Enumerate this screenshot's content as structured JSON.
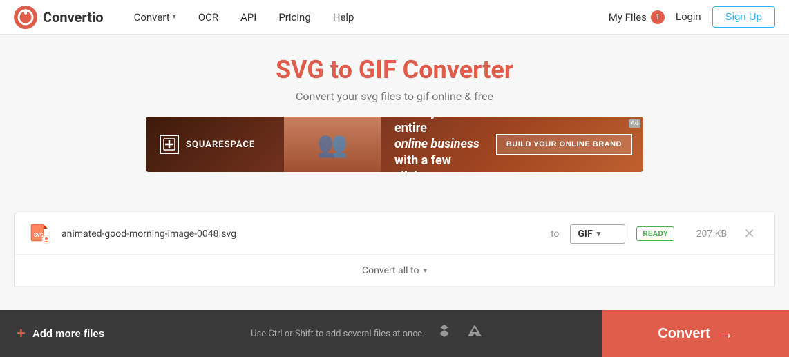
{
  "header": {
    "logo_text": "Convertio",
    "nav": [
      {
        "label": "Convert",
        "has_chevron": true
      },
      {
        "label": "OCR",
        "has_chevron": false
      },
      {
        "label": "API",
        "has_chevron": false
      },
      {
        "label": "Pricing",
        "has_chevron": false
      },
      {
        "label": "Help",
        "has_chevron": false
      }
    ],
    "my_files_label": "My Files",
    "my_files_count": "1",
    "login_label": "Login",
    "signup_label": "Sign Up"
  },
  "main": {
    "title": "SVG to GIF Converter",
    "subtitle": "Convert your svg files to gif online & free"
  },
  "ad": {
    "brand": "SQUARESPACE",
    "headline_line1": "Brand your entire",
    "headline_line2": "online business",
    "headline_line3": "with a few clicks.",
    "cta": "BUILD YOUR ONLINE BRAND",
    "label": "Ad"
  },
  "file_row": {
    "filename": "animated-good-morning-image-0048.svg",
    "to_label": "to",
    "format": "GIF",
    "status": "READY",
    "size": "207 KB"
  },
  "convert_all": {
    "label": "Convert all to"
  },
  "bottom_bar": {
    "add_files_label": "Add more files",
    "drop_hint": "Use Ctrl or Shift to add several files at once",
    "convert_label": "Convert"
  }
}
